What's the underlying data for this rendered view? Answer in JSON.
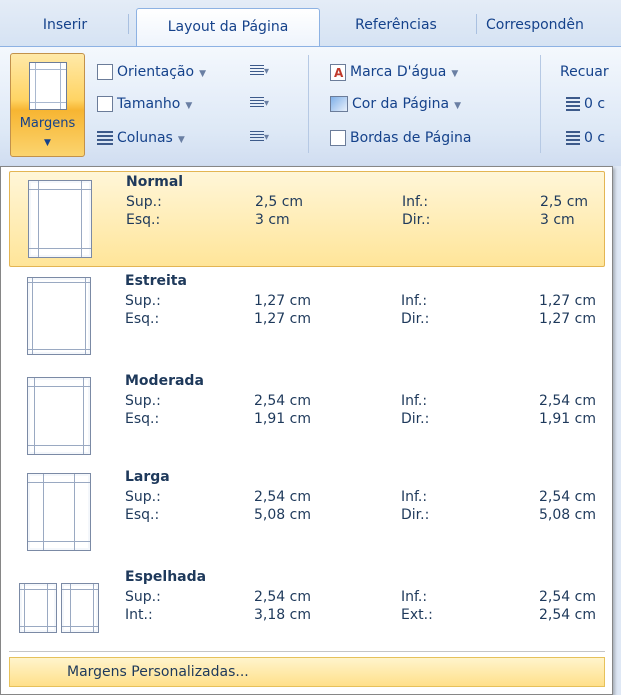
{
  "tabs": [
    "Inserir",
    "Layout da Página",
    "Referências",
    "Correspondên"
  ],
  "ribbon": {
    "margens_label": "Margens",
    "orientacao": "Orientação",
    "tamanho": "Tamanho",
    "colunas": "Colunas",
    "marca_dagua": "Marca D'água",
    "cor_pagina": "Cor da Página",
    "bordas_pagina": "Bordas de Página",
    "recuar": "Recuar",
    "recuo_esq": "0 c",
    "recuo_dir": "0 c"
  },
  "options": [
    {
      "name": "Normal",
      "l1": "Sup.:",
      "v1": "2,5 cm",
      "l2": "Esq.:",
      "v2": "3 cm",
      "r1": "Inf.:",
      "rv1": "2,5 cm",
      "r2": "Dir.:",
      "rv2": "3 cm"
    },
    {
      "name": "Estreita",
      "l1": "Sup.:",
      "v1": "1,27 cm",
      "l2": "Esq.:",
      "v2": "1,27 cm",
      "r1": "Inf.:",
      "rv1": "1,27 cm",
      "r2": "Dir.:",
      "rv2": "1,27 cm"
    },
    {
      "name": "Moderada",
      "l1": "Sup.:",
      "v1": "2,54 cm",
      "l2": "Esq.:",
      "v2": "1,91 cm",
      "r1": "Inf.:",
      "rv1": "2,54 cm",
      "r2": "Dir.:",
      "rv2": "1,91 cm"
    },
    {
      "name": "Larga",
      "l1": "Sup.:",
      "v1": "2,54 cm",
      "l2": "Esq.:",
      "v2": "5,08 cm",
      "r1": "Inf.:",
      "rv1": "2,54 cm",
      "r2": "Dir.:",
      "rv2": "5,08 cm"
    },
    {
      "name": "Espelhada",
      "l1": "Sup.:",
      "v1": "2,54 cm",
      "l2": "Int.:",
      "v2": "3,18 cm",
      "r1": "Inf.:",
      "rv1": "2,54 cm",
      "r2": "Ext.:",
      "rv2": "2,54 cm"
    }
  ],
  "custom_margins": "Margens Personalizadas...",
  "colors": {
    "accent": "#15428b",
    "selected_bg": "#ffe599",
    "ribbon_bg": "#dfe8f5"
  }
}
